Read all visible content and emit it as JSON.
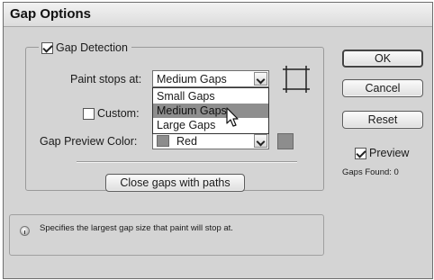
{
  "dialog": {
    "title": "Gap Options",
    "gap_detection": {
      "label": "Gap Detection",
      "checked": true
    },
    "paint_stops": {
      "label": "Paint stops at:",
      "value": "Medium Gaps",
      "options": [
        "Small Gaps",
        "Medium Gaps",
        "Large Gaps"
      ],
      "highlighted": "Medium Gaps"
    },
    "custom": {
      "label": "Custom:",
      "checked": false
    },
    "preview_color": {
      "label": "Gap Preview Color:",
      "value": "Red",
      "swatch_color": "#8d8d8d"
    },
    "close_gaps_label": "Close gaps with paths",
    "info_text": "Specifies the largest gap size that paint will stop at.",
    "buttons": {
      "ok": "OK",
      "cancel": "Cancel",
      "reset": "Reset"
    },
    "preview": {
      "label": "Preview",
      "checked": true
    },
    "gaps_found": "Gaps Found: 0"
  }
}
